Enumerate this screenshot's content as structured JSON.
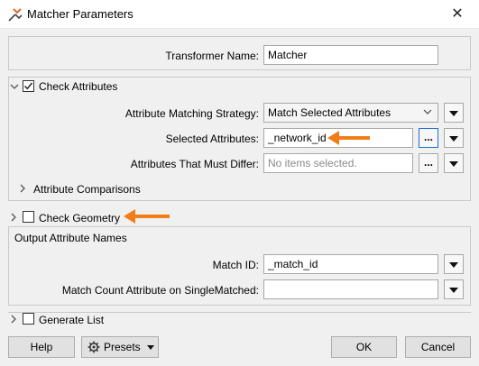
{
  "window": {
    "title": "Matcher Parameters",
    "close_glyph": "✕"
  },
  "transformer": {
    "label": "Transformer Name:",
    "value": "Matcher"
  },
  "check_attributes": {
    "label": "Check Attributes",
    "checked": true,
    "strategy": {
      "label": "Attribute Matching Strategy:",
      "value": "Match Selected Attributes"
    },
    "selected": {
      "label": "Selected Attributes:",
      "value": "_network_id",
      "button": "..."
    },
    "differ": {
      "label": "Attributes That Must Differ:",
      "placeholder": "No items selected.",
      "button": "..."
    },
    "comparisons": {
      "label": "Attribute Comparisons"
    }
  },
  "check_geometry": {
    "label": "Check Geometry",
    "checked": false
  },
  "output": {
    "heading": "Output Attribute Names",
    "match_id": {
      "label": "Match ID:",
      "value": "_match_id"
    },
    "match_count": {
      "label": "Match Count Attribute on SingleMatched:",
      "value": ""
    }
  },
  "generate_list": {
    "label": "Generate List",
    "checked": false
  },
  "footer": {
    "help": "Help",
    "presets": "Presets",
    "ok": "OK",
    "cancel": "Cancel"
  },
  "colors": {
    "accent_arrow": "#f07d1a",
    "focus_blue": "#1f6fd6",
    "dialog_bg": "#f0f0f0"
  },
  "icons": [
    "app-icon",
    "close-icon",
    "chevron-down-icon",
    "chevron-right-icon",
    "checkbox-icon",
    "gear-icon",
    "dropdown-arrow-icon",
    "arrow-icon"
  ]
}
